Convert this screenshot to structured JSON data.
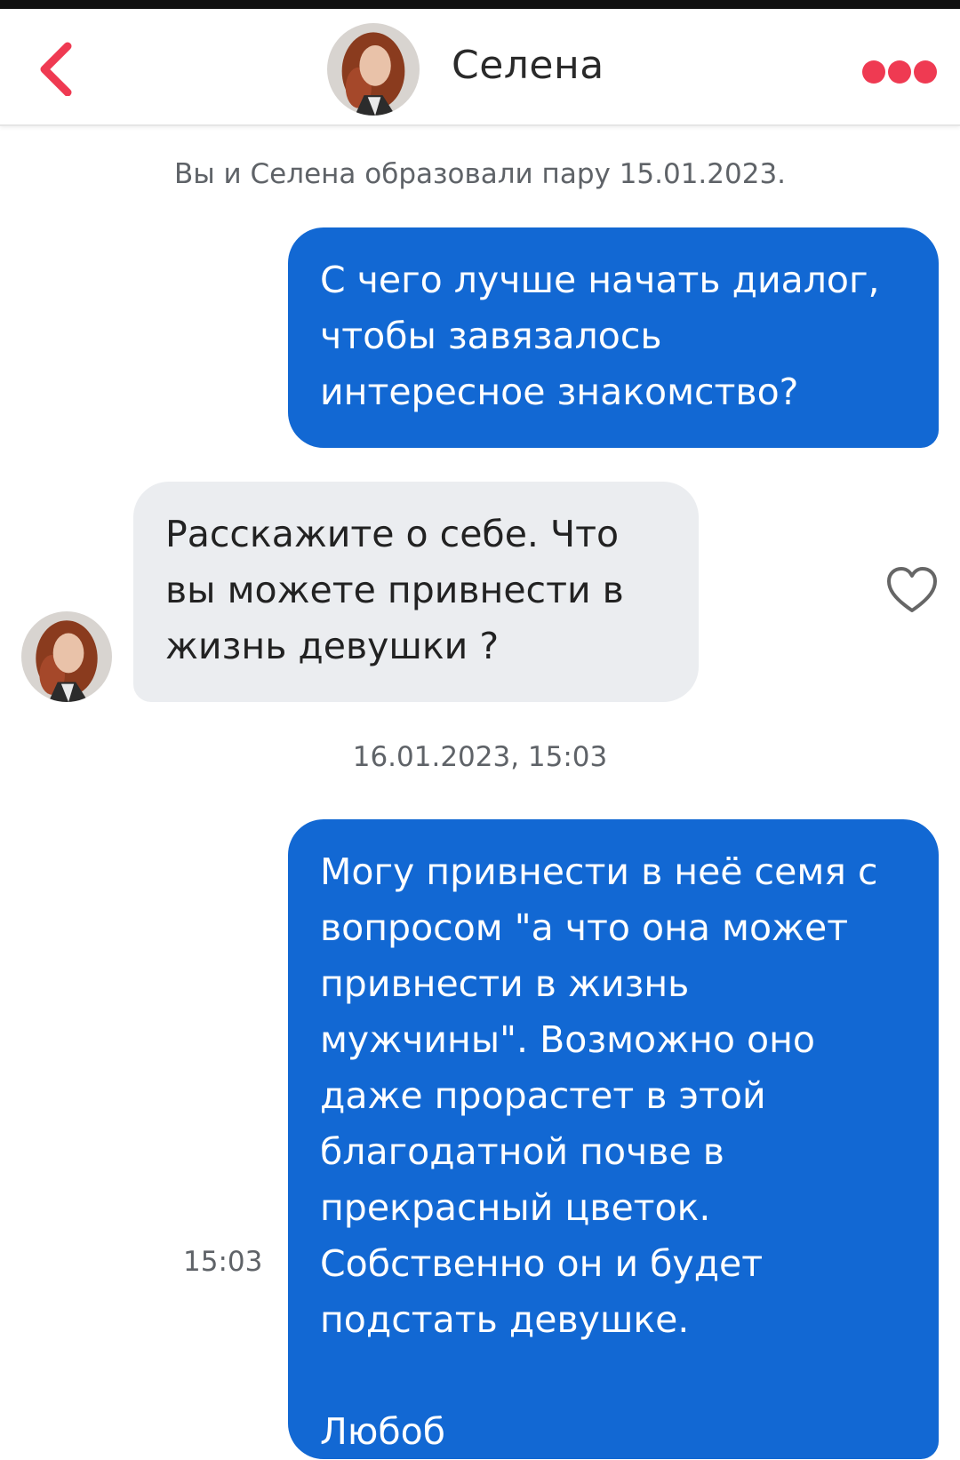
{
  "header": {
    "contact_name": "Селена",
    "back_icon": "chevron-left-icon",
    "more_icon": "more-dots-icon",
    "accent_color": "#ef3a52"
  },
  "chat": {
    "match_note": "Вы и Селена образовали пару 15.01.2023.",
    "messages": [
      {
        "direction": "outgoing",
        "text": "С чего лучше начать диалог,\nчтобы завязалось\nинтересное знакомство?"
      },
      {
        "direction": "incoming",
        "text": "Расскажите о себе. Что\nвы можете привнести в\nжизнь девушки ?"
      },
      {
        "direction": "outgoing",
        "time": "15:03",
        "text": "Могу привнести в неё семя с\nвопросом \"а что она может\nпривнести в жизнь\nмужчины\". Возможно оно\nдаже прорастет в этой\nблагодатной почве в\nпрекрасный цветок.\nСобственно он и будет\nподстать девушке.\n\nЛюбоб"
      }
    ],
    "date_separator": "16.01.2023, 15:03",
    "like_icon": "heart-outline-icon",
    "colors": {
      "outgoing_bubble": "#1268d3",
      "incoming_bubble": "#ebedf0"
    }
  }
}
